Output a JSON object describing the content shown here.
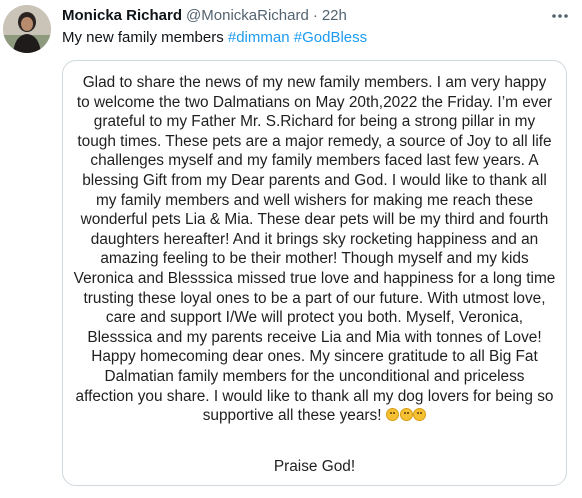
{
  "tweet": {
    "display_name": "Monicka Richard",
    "handle": "@MonickaRichard",
    "separator": "·",
    "time": "22h",
    "text_prefix": "My new family members",
    "hashtags": [
      "#dimman",
      "#GodBless"
    ],
    "more_icon": "more-horizontal-icon",
    "avatar_icon": "profile-photo"
  },
  "letter": {
    "lines": [
      "Glad to share the news of my new family members. I am very happy",
      "to welcome the two Dalmatians on May 20th,2022 the Friday. I’m ever",
      "grateful to my Father Mr. S.Richard for being a strong pillar in my",
      "tough times. These pets are a major remedy, a source of Joy to all life",
      "challenges myself and my family members faced last few years. A",
      "blessing Gift from my Dear parents and God. I would like to thank all",
      "my family members and well wishers for making me reach these",
      "wonderful pets Lia & Mia. These dear pets will be my third and fourth",
      "daughters hereafter! And it brings sky rocketing happiness and an",
      "amazing feeling to be their mother! Though myself and my kids",
      "Veronica and Blesssica missed true love and happiness for a long time",
      "trusting these loyal ones to be a part of our future. With utmost love,",
      "care and support I/We will protect you both. Myself, Veronica,",
      "Blesssica and my parents receive Lia and Mia with tonnes of Love!",
      "Happy homecoming dear ones. My sincere gratitude to all Big Fat",
      "Dalmatian family members for the unconditional and priceless",
      "affection you share. I would like to thank all my dog lovers for being so",
      "supportive all these years!"
    ],
    "emojis": [
      "laughing-tears-emoji",
      "woozy-face-emoji",
      "tongue-out-emoji"
    ],
    "closing": "Praise God!"
  }
}
